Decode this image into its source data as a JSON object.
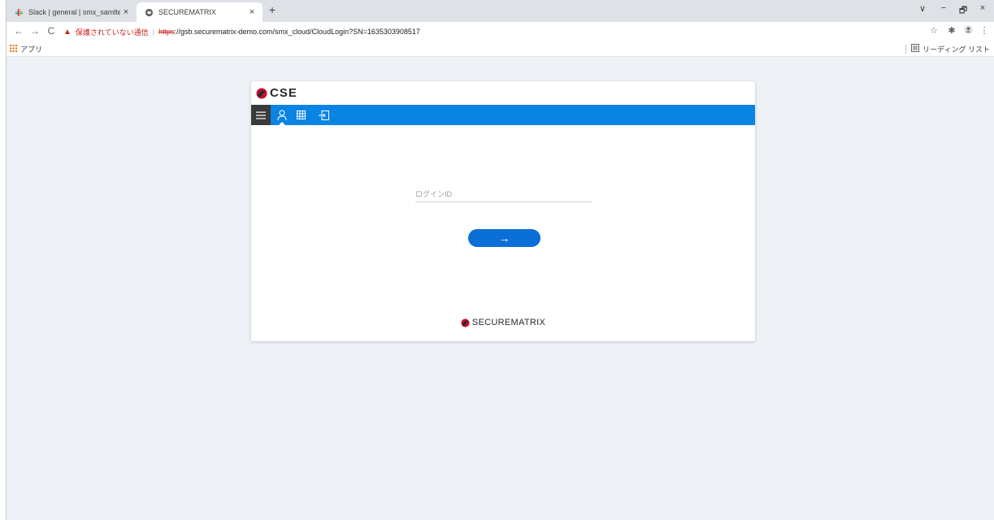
{
  "browser": {
    "tabs": [
      {
        "title": "Slack | general | smx_samltest",
        "close": "×"
      },
      {
        "title": "SECUREMATRIX",
        "close": "×"
      }
    ],
    "new_tab": "+",
    "window_controls": {
      "tab_search": "∨",
      "minimize": "−",
      "restore": "🗗",
      "close": "×"
    }
  },
  "address_bar": {
    "back": "←",
    "forward": "→",
    "reload": "C",
    "warning_icon": "▲",
    "security_warning": "保護されていない通信",
    "separator": "|",
    "url_scheme": "https",
    "url_rest": "://gsb.securematrix-demo.com/smx_cloud/CloudLogin?SN=1635303908517",
    "star": "☆",
    "extensions": "✱",
    "menu": "⋮"
  },
  "bookmarks": {
    "apps_label": "アプリ",
    "reading_list": "リーディング リスト"
  },
  "card": {
    "brand": "CSE",
    "login_placeholder": "ログインID",
    "submit_label": "→",
    "footer_brand": "SECUREMATRIX"
  },
  "colors": {
    "nav_blue": "#0a84e3",
    "button_blue": "#0b6fd8",
    "brand_red": "#c8102e",
    "page_bg": "#eef1f6"
  }
}
